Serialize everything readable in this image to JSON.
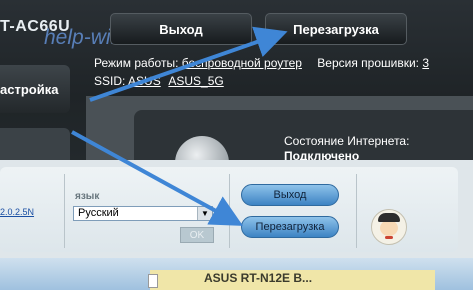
{
  "header": {
    "brand_fragment": "T-AC66U",
    "watermark": "help-wifi.com",
    "logout_label": "Выход",
    "reboot_label": "Перезагрузка"
  },
  "info": {
    "mode_label": "Режим работы:",
    "mode_value": "беспроводной роутер",
    "firmware_label": "Версия прошивки:",
    "firmware_value": "3",
    "ssid_label": "SSID:",
    "ssid_values": [
      "ASUS",
      "ASUS_5G"
    ]
  },
  "sidebar": {
    "setup_label": "астройка"
  },
  "status": {
    "line1": "Состояние Интернета:",
    "line2": "Подключено"
  },
  "bottom": {
    "firmware_link": "2.0.2.5N",
    "language_label": "язык",
    "language_selected": "Русский",
    "ok_label": "OK",
    "logout_label": "Выход",
    "reboot_label": "Перезагрузка",
    "footer_text": "ASUS RT-N12E B..."
  },
  "colors": {
    "arrow": "#3f86d6",
    "pill": "#5ea2dd"
  }
}
